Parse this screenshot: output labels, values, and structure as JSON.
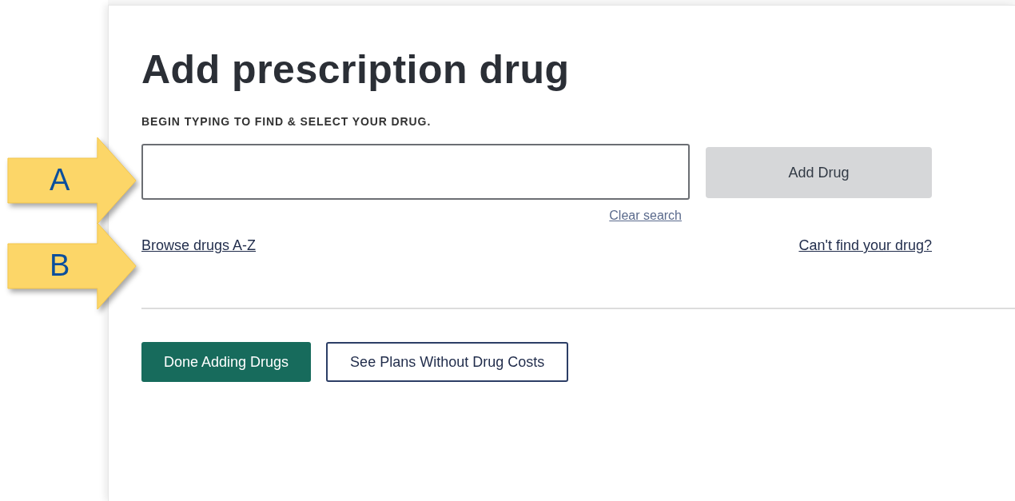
{
  "title": "Add prescription drug",
  "search": {
    "label": "BEGIN TYPING TO FIND & SELECT YOUR DRUG.",
    "clear_link": "Clear search"
  },
  "add_button": {
    "label": "Add Drug",
    "disabled": true
  },
  "links": {
    "browse": "Browse drugs A-Z",
    "cant_find": "Can't find your drug?"
  },
  "actions": [
    {
      "label": "Done Adding Drugs",
      "kind": "primary"
    },
    {
      "label": "See Plans Without Drug Costs",
      "kind": "secondary"
    }
  ],
  "callouts": [
    {
      "label": "A"
    },
    {
      "label": "B"
    }
  ]
}
